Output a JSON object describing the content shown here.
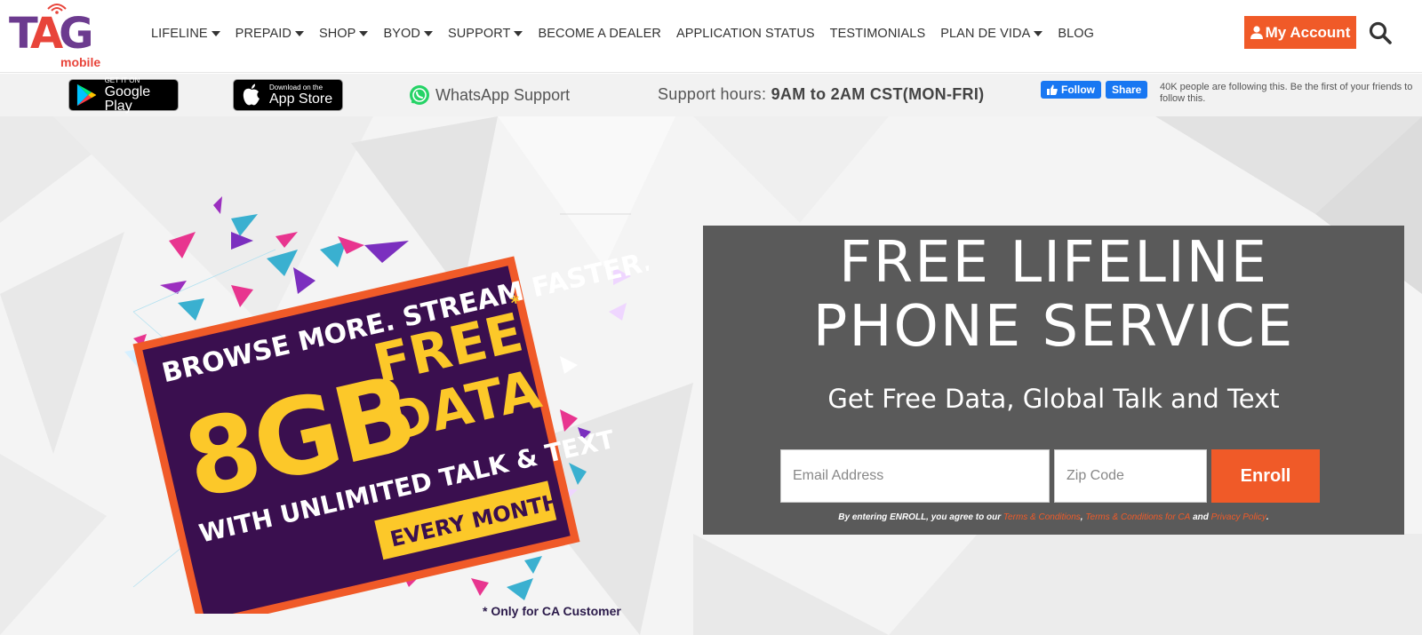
{
  "header": {
    "logo": {
      "text_t": "T",
      "text_a": "A",
      "text_g": "G",
      "sub": "mobile"
    },
    "nav": [
      {
        "label": "LIFELINE",
        "dropdown": true
      },
      {
        "label": "PREPAID",
        "dropdown": true
      },
      {
        "label": "SHOP",
        "dropdown": true
      },
      {
        "label": "BYOD",
        "dropdown": true
      },
      {
        "label": "SUPPORT",
        "dropdown": true
      },
      {
        "label": "BECOME A DEALER",
        "dropdown": false
      },
      {
        "label": "APPLICATION STATUS",
        "dropdown": false
      },
      {
        "label": "TESTIMONIALS",
        "dropdown": false
      },
      {
        "label": "PLAN DE VIDA",
        "dropdown": true
      },
      {
        "label": "BLOG",
        "dropdown": false
      }
    ],
    "account_label": "My Account",
    "search_icon": "search-icon"
  },
  "subbar": {
    "google_play": {
      "small": "GET IT ON",
      "big": "Google Play"
    },
    "app_store": {
      "small": "Download on the",
      "big": "App Store"
    },
    "whatsapp_label": "WhatsApp Support",
    "support_hours_label": "Support hours: ",
    "support_hours_value": "9AM to 2AM CST(MON-FRI)",
    "facebook": {
      "follow_label": "Follow",
      "share_label": "Share",
      "followers_text": "40K people are following this. Be the first of your friends to follow this."
    }
  },
  "hero": {
    "promo": {
      "line1": "BROWSE MORE. STREAM FASTER.",
      "amount": "8GB",
      "free": "FREE",
      "data": "DATA",
      "asterisk": "*",
      "line3": "WITH UNLIMITED TALK & TEXT",
      "line4": "EVERY MONTH"
    },
    "cta": {
      "title_line1": "FREE LIFELINE",
      "title_line2": "PHONE SERVICE",
      "subtitle": "Get Free Data, Global Talk and Text",
      "email_placeholder": "Email Address",
      "zip_placeholder": "Zip Code",
      "enroll_label": "Enroll",
      "terms_prefix": "By entering ENROLL, you agree to our ",
      "terms_link1": "Terms & Conditions",
      "terms_sep": ", ",
      "terms_link2": "Terms & Conditions for CA",
      "terms_and": " and ",
      "terms_link3": "Privacy Policy",
      "terms_end": "."
    },
    "ca_note": "* Only for CA Customer"
  },
  "colors": {
    "accent": "#f05a28",
    "brand_purple": "#6c3b8f",
    "panel": "#5a5a5a",
    "promo_bg": "#3a0f4f",
    "promo_yellow": "#fcc829",
    "facebook": "#1877f2"
  }
}
